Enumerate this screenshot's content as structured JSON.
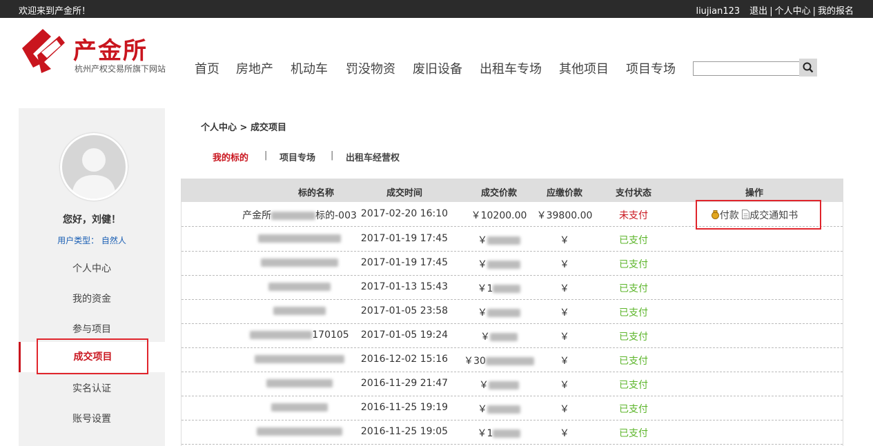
{
  "topbar": {
    "welcome": "欢迎来到产金所！",
    "username": "liujian123",
    "logout": "退出",
    "sep": "|",
    "personal_center": "个人中心",
    "my_signups": "我的报名"
  },
  "brand": {
    "name": "产金所",
    "subtitle": "杭州产权交易所旗下网站",
    "color": "#c9151e"
  },
  "nav": [
    "首页",
    "房地产",
    "机动车",
    "罚没物资",
    "废旧设备",
    "出租车专场",
    "其他项目",
    "项目专场"
  ],
  "search": {
    "value": "",
    "icon": "search-icon"
  },
  "sidebar": {
    "greeting": "您好，刘健！",
    "user_type": "用户类型： 自然人",
    "items": [
      "个人中心",
      "我的资金",
      "参与项目",
      "成交项目",
      "实名认证",
      "账号设置"
    ],
    "active_index": 3
  },
  "breadcrumb": "个人中心 > 成交项目",
  "subtabs": {
    "items": [
      "我的标的",
      "项目专场",
      "出租车经营权"
    ],
    "sep": "|"
  },
  "table": {
    "headers": [
      "标的名称",
      "成交时间",
      "成交价款",
      "应缴价款",
      "支付状态",
      "操作"
    ],
    "rows": [
      {
        "name": "产金所",
        "name_tail": "标的-003",
        "time": "2017-02-20 16:10",
        "price": "￥10200.00",
        "due": "￥39800.00",
        "status": "未支付",
        "paid": false,
        "ops": [
          "付款",
          "成交通知书"
        ]
      },
      {
        "name": "",
        "name_tail": "",
        "time": "2017-01-19 17:45",
        "price": "￥",
        "due": "￥",
        "status": "已支付",
        "paid": true,
        "ops": []
      },
      {
        "name": "",
        "name_tail": "",
        "time": "2017-01-19 17:45",
        "price": "￥",
        "due": "￥",
        "status": "已支付",
        "paid": true,
        "ops": []
      },
      {
        "name": "",
        "name_tail": "",
        "time": "2017-01-13 15:43",
        "price": "￥1",
        "due": "￥",
        "status": "已支付",
        "paid": true,
        "ops": []
      },
      {
        "name": "",
        "name_tail": "",
        "time": "2017-01-05 23:58",
        "price": "￥",
        "due": "￥",
        "status": "已支付",
        "paid": true,
        "ops": []
      },
      {
        "name": "",
        "name_tail": "170105",
        "time": "2017-01-05 19:24",
        "price": "￥",
        "due": "￥",
        "status": "已支付",
        "paid": true,
        "ops": []
      },
      {
        "name": "",
        "name_tail": "",
        "time": "2016-12-02 15:16",
        "price": "￥30",
        "due": "￥",
        "status": "已支付",
        "paid": true,
        "ops": []
      },
      {
        "name": "",
        "name_tail": "",
        "time": "2016-11-29 21:47",
        "price": "￥",
        "due": "￥",
        "status": "已支付",
        "paid": true,
        "ops": []
      },
      {
        "name": "",
        "name_tail": "",
        "time": "2016-11-25 19:19",
        "price": "￥",
        "due": "￥",
        "status": "已支付",
        "paid": true,
        "ops": []
      },
      {
        "name": "",
        "name_tail": "",
        "time": "2016-11-25 19:05",
        "price": "￥1",
        "due": "￥",
        "status": "已支付",
        "paid": true,
        "ops": []
      }
    ]
  },
  "colors": {
    "unpaid": "#c9151e",
    "paid": "#5cb52a",
    "highlight": "#e0242b"
  }
}
